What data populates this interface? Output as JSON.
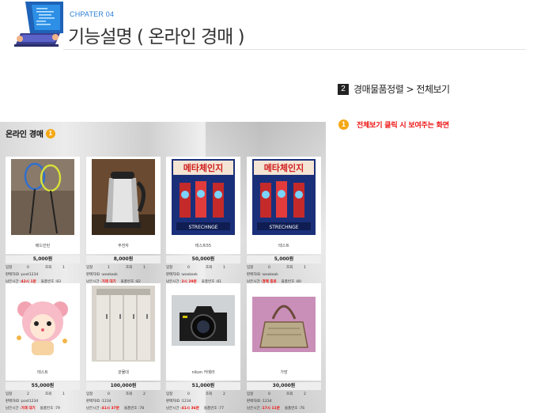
{
  "header": {
    "chapter": "CHPATER 04",
    "title": "기능설명 ( 온라인 경매 )"
  },
  "step": {
    "number": "2",
    "text": "경매물품정렬 > 전체보기"
  },
  "note": {
    "badge": "1",
    "text": "전체보기 클릭 시 보여주는 화면"
  },
  "panel": {
    "title": "온라인 경매",
    "badge": "1",
    "labels": {
      "bids": "입찰",
      "views": "조회",
      "seller": "판매자ID : ",
      "remaining": "남은시간 : ",
      "item_no": "물품번호 : "
    },
    "cards": [
      {
        "name": "배드민턴",
        "price": "5,000원",
        "bids": "0",
        "views": "1",
        "seller": "post1234",
        "time": "42시 1분",
        "no": "83",
        "img": "badminton"
      },
      {
        "name": "주전자",
        "price": "8,000원",
        "bids": "1",
        "views": "1",
        "seller": "wookook",
        "time": "거래 대기",
        "no": "82",
        "img": "kettle"
      },
      {
        "name": "테스트55",
        "price": "50,000원",
        "bids": "0",
        "views": "1",
        "seller": "wookook",
        "time": "2시 29분",
        "no": "81",
        "img": "poster"
      },
      {
        "name": "테스트",
        "price": "5,000원",
        "bids": "0",
        "views": "1",
        "seller": "wookook",
        "time": "경매 종료",
        "no": "80",
        "img": "poster"
      },
      {
        "name": "테스트",
        "price": "55,000원",
        "bids": "2",
        "views": "1",
        "seller": "post1234",
        "time": "거래 대기",
        "no": "79",
        "img": "bear"
      },
      {
        "name": "관물대",
        "price": "100,000원",
        "bids": "0",
        "views": "2",
        "seller": "1234",
        "time": "41시 37분",
        "no": "78",
        "img": "locker"
      },
      {
        "name": "nikon 카메라",
        "price": "51,000원",
        "bids": "0",
        "views": "2",
        "seller": "1234",
        "time": "41시 36분",
        "no": "77",
        "img": "camera"
      },
      {
        "name": "가방",
        "price": "30,000원",
        "bids": "0",
        "views": "2",
        "seller": "1234",
        "time": "17시 11분",
        "no": "76",
        "img": "bag"
      }
    ]
  },
  "colors": {
    "accent_blue": "#2b7fd6",
    "badge_orange": "#f4a814",
    "alert_red": "#e11111"
  }
}
